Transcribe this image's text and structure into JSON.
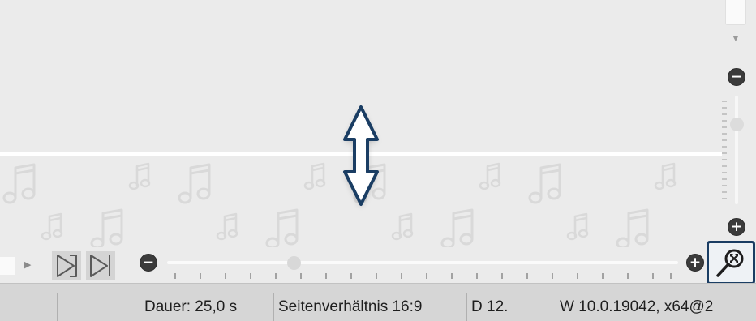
{
  "status_bar": {
    "duration": "Dauer: 25,0 s",
    "aspect_ratio": "Seitenverhältnis 16:9",
    "date": "D 12.",
    "version": "W 10.0.19042, x64@2"
  },
  "zoom_controls": {
    "vertical_minus_label": "−",
    "vertical_plus_label": "+",
    "horizontal_minus_label": "−",
    "horizontal_plus_label": "+",
    "vertical_zoom_level": 0.2,
    "horizontal_zoom_level": 0.25
  },
  "icons": {
    "cursor": "vertical-resize-cursor-icon",
    "music": "music-note-icon",
    "mark_in": "mark-in-icon",
    "skip_end": "skip-to-end-icon",
    "zoom_fit": "zoom-to-fit-icon",
    "scroll_down": "scroll-down-arrow-icon",
    "play": "play-small-icon"
  },
  "colors": {
    "background": "#ebebeb",
    "status_bar": "#d6d6d6",
    "accent": "#1a3d63",
    "button_dark": "#3b3b3b",
    "splitter": "#ffffff"
  }
}
